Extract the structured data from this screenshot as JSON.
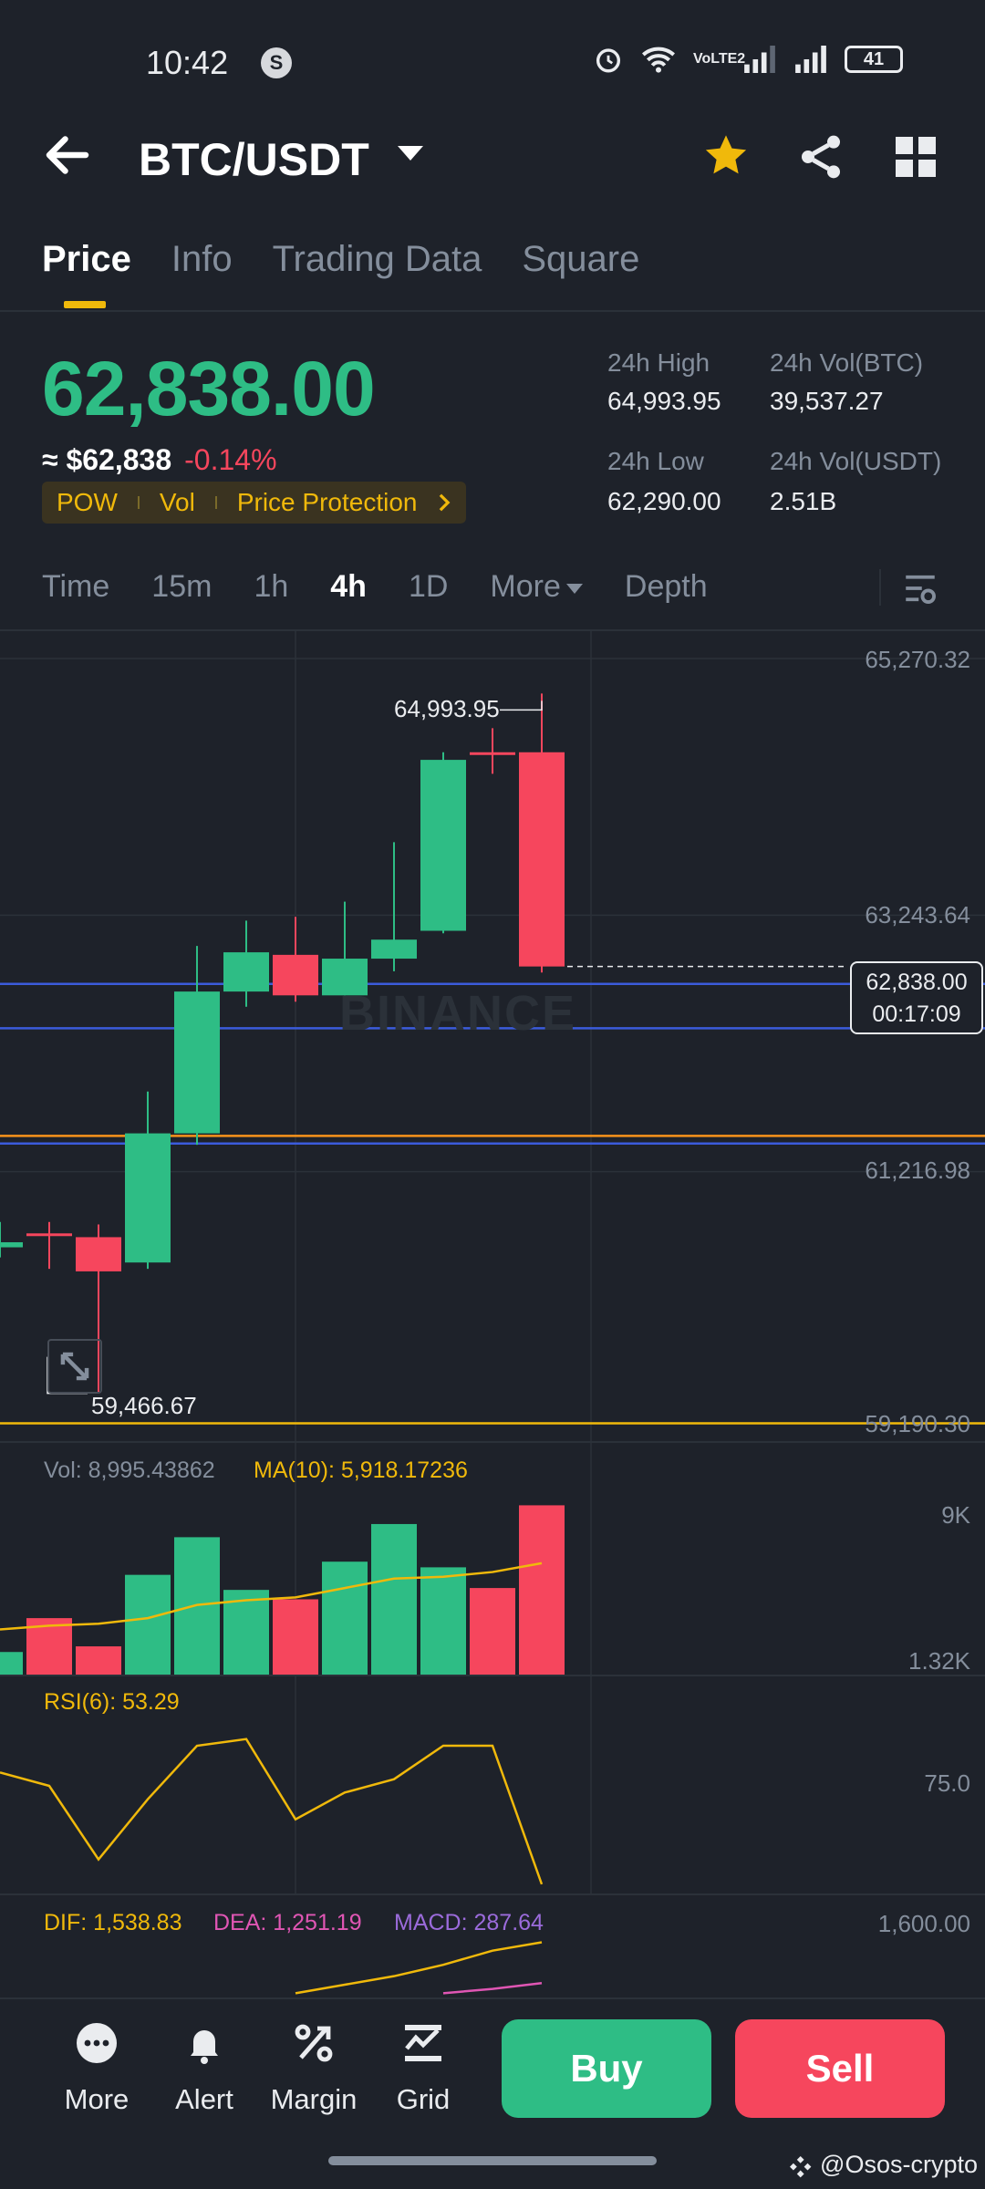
{
  "status_bar": {
    "time": "10:42",
    "app_icon_letter": "S",
    "network": "VoLTE2",
    "battery": "41"
  },
  "header": {
    "pair": "BTC/USDT",
    "favorite_color": "#f0b90b"
  },
  "tabs": [
    "Price",
    "Info",
    "Trading Data",
    "Square"
  ],
  "price": {
    "last": "62,838.00",
    "fiat": "≈ $62,838",
    "change_pct": "-0.14%",
    "tags": [
      "POW",
      "Vol",
      "Price Protection"
    ],
    "high_label": "24h High",
    "high": "64,993.95",
    "low_label": "24h Low",
    "low": "62,290.00",
    "vol_btc_label": "24h Vol(BTC)",
    "vol_btc": "39,537.27",
    "vol_usdt_label": "24h Vol(USDT)",
    "vol_usdt": "2.51B"
  },
  "timeframes": [
    "Time",
    "15m",
    "1h",
    "4h",
    "1D",
    "More",
    "Depth"
  ],
  "active_timeframe": "4h",
  "chart": {
    "axis_labels": [
      "65,270.32",
      "63,243.64",
      "61,216.98",
      "59,190.30"
    ],
    "high_marker": "64,993.95",
    "low_marker": "59,466.67",
    "current_price": "62,838.00",
    "countdown": "00:17:09",
    "watermark": "BINANCE"
  },
  "indicators": {
    "vol_label": "Vol: 8,995.43862",
    "ma_label": "MA(10): 5,918.17236",
    "vol_axis_top": "9K",
    "vol_axis_bottom": "1.32K",
    "rsi_label": "RSI(6): 53.29",
    "rsi_axis": "75.0",
    "dif_label": "DIF: 1,538.83",
    "dea_label": "DEA: 1,251.19",
    "macd_label": "MACD: 287.64",
    "macd_axis": "1,600.00"
  },
  "bottom_nav": {
    "more": "More",
    "alert": "Alert",
    "margin": "Margin",
    "grid": "Grid",
    "buy": "Buy",
    "sell": "Sell"
  },
  "credit": "@Osos-crypto",
  "chart_data": {
    "type": "candlestick",
    "timeframe": "4h",
    "ylim": [
      59190.3,
      65270.32
    ],
    "candles": [
      {
        "open": 60620,
        "high": 60820,
        "low": 60540,
        "close": 60660
      },
      {
        "open": 60730,
        "high": 60820,
        "low": 60450,
        "close": 60710
      },
      {
        "open": 60700,
        "high": 60800,
        "low": 59466.67,
        "close": 60430
      },
      {
        "open": 60500,
        "high": 61850,
        "low": 60450,
        "close": 61520
      },
      {
        "open": 61520,
        "high": 63000,
        "low": 61430,
        "close": 62640
      },
      {
        "open": 62640,
        "high": 63200,
        "low": 62520,
        "close": 62950
      },
      {
        "open": 62930,
        "high": 63230,
        "low": 62560,
        "close": 62610
      },
      {
        "open": 62610,
        "high": 63350,
        "low": 62610,
        "close": 62900
      },
      {
        "open": 62900,
        "high": 63820,
        "low": 62800,
        "close": 63050
      },
      {
        "open": 63120,
        "high": 64530,
        "low": 63100,
        "close": 64470
      },
      {
        "open": 64530,
        "high": 64720,
        "low": 64360,
        "close": 64520
      },
      {
        "open": 64530,
        "high": 64993.95,
        "low": 62790,
        "close": 62838
      }
    ],
    "horizontal_lines": [
      {
        "price": 62700,
        "color": "#3b5bdb"
      },
      {
        "price": 62350,
        "color": "#3b5bdb"
      },
      {
        "price": 61500,
        "color": "#f7931a"
      },
      {
        "price": 61440,
        "color": "#3b5bdb"
      },
      {
        "price": 59230,
        "color": "#f0b90b"
      }
    ],
    "volume": [
      1200,
      3000,
      1500,
      5300,
      7300,
      4500,
      4000,
      6000,
      8000,
      5700,
      4600,
      8995.43862
    ],
    "volume_ma": [
      2400,
      2600,
      2700,
      3000,
      3700,
      3950,
      4100,
      4600,
      5100,
      5200,
      5450,
      5918.17236
    ],
    "volume_ylim": [
      0,
      9500
    ],
    "rsi": [
      70,
      68,
      57,
      66,
      74,
      75,
      63,
      67,
      69,
      74,
      74,
      53.29
    ],
    "rsi_ylim": [
      50,
      80
    ],
    "dif": [
      1180,
      1240,
      1300,
      1380,
      1480,
      1538.83
    ],
    "dea": [
      1180,
      1210,
      1251.19
    ],
    "macd_ylim": [
      1150,
      1600
    ]
  },
  "colors": {
    "up": "#2ebd85",
    "down": "#f6465d",
    "accent": "#f0b90b",
    "ma": "#f0b90b",
    "rsi": "#f0b90b",
    "dif": "#f0b90b",
    "dea": "#e056b4",
    "macd": "#9b6bdb"
  }
}
